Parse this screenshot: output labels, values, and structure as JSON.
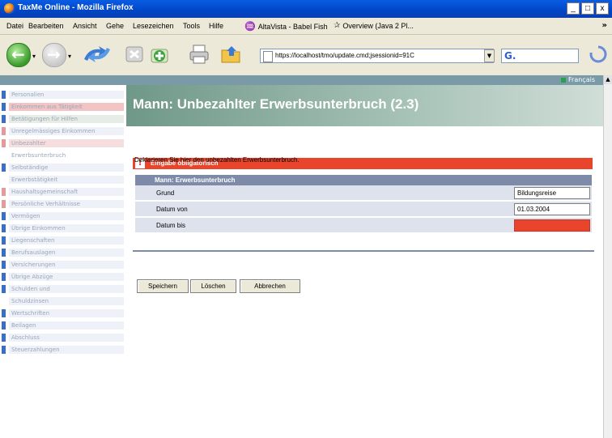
{
  "window": {
    "title": "TaxMe Online - Mozilla Firefox",
    "buttons": [
      "_",
      "□",
      "x"
    ]
  },
  "menu": {
    "items": [
      "Datei",
      "Bearbeiten",
      "Ansicht",
      "Gehe",
      "Lesezeichen",
      "Tools",
      "Hilfe"
    ],
    "bookmarks": [
      "AltaVista - Babel Fish",
      "Overview (Java 2 Pl..."
    ],
    "overflow": "»"
  },
  "toolbar": {
    "url": "https://localhost/tmo/update.cmd;jsessionid=91C",
    "search_value": "G."
  },
  "page": {
    "language": "Français",
    "title": "Mann: Unbezahlter Erwerbsunterbruch (2.3)",
    "error_label": "Eingabe obligatorisch",
    "error_mark": "!",
    "intro": "Deklarieren Sie hier den unbezahlten Erwerbsunterbruch.",
    "section_title": "Mann: Erwerbsunterbruch",
    "fields": [
      {
        "label": "Grund",
        "value": "Bildungsreise",
        "error": false
      },
      {
        "label": "Datum von",
        "value": "01.03.2004",
        "error": false
      },
      {
        "label": "Datum bis",
        "value": "",
        "error": true
      }
    ],
    "buttons": [
      "Speichern",
      "Löschen",
      "Abbrechen"
    ]
  },
  "sidebar": {
    "items": [
      {
        "label": "Personalien",
        "marker": "#3a6fc8",
        "bg": "#eef2f8"
      },
      {
        "label": "Einkommen aus Tätigkeit",
        "marker": "#3a6fc8",
        "bg": "#f2c4c4"
      },
      {
        "label": "Betätigungen für Hilfen",
        "marker": "#3a6fc8",
        "bg": "#e6ece6"
      },
      {
        "label": "Unregelmässiges Einkommen",
        "marker": "#e59a9a",
        "bg": "#eef2f8"
      },
      {
        "label": "Unbezahlter",
        "marker": "#e59a9a",
        "bg": "#f6dede"
      },
      {
        "label": "Erwerbsunterbruch",
        "marker": "#ffffff",
        "bg": "#ffffff"
      },
      {
        "label": "Selbständige",
        "marker": "#3a6fc8",
        "bg": "#eef2f8"
      },
      {
        "label": "Erwerbstätigkeit",
        "marker": "#ffffff",
        "bg": "#eef2f8"
      },
      {
        "label": "Haushaltsgemeinschaft",
        "marker": "#e59a9a",
        "bg": "#eef2f8"
      },
      {
        "label": "Persönliche Verhältnisse",
        "marker": "#e59a9a",
        "bg": "#eef2f8"
      },
      {
        "label": "Vermögen",
        "marker": "#3a6fc8",
        "bg": "#eef2f8"
      },
      {
        "label": "Übrige Einkommen",
        "marker": "#3a6fc8",
        "bg": "#eef2f8"
      },
      {
        "label": "Liegenschaften",
        "marker": "#3a6fc8",
        "bg": "#eef2f8"
      },
      {
        "label": "Berufsauslagen",
        "marker": "#3a6fc8",
        "bg": "#eef2f8"
      },
      {
        "label": "Versicherungen",
        "marker": "#3a6fc8",
        "bg": "#eef2f8"
      },
      {
        "label": "Übrige Abzüge",
        "marker": "#3a6fc8",
        "bg": "#eef2f8"
      },
      {
        "label": "Schulden und",
        "marker": "#3a6fc8",
        "bg": "#eef2f8"
      },
      {
        "label": "Schuldzinsen",
        "marker": "#ffffff",
        "bg": "#eef2f8"
      },
      {
        "label": "Wertschriften",
        "marker": "#3a6fc8",
        "bg": "#eef2f8"
      },
      {
        "label": "Beilagen",
        "marker": "#3a6fc8",
        "bg": "#eef2f8"
      },
      {
        "label": "Abschluss",
        "marker": "#3a6fc8",
        "bg": "#eef2f8"
      },
      {
        "label": "Steuerzahlungen",
        "marker": "#3a6fc8",
        "bg": "#eef2f8"
      }
    ]
  },
  "colors": {
    "title_bar": "#0046c7",
    "header_green": "#6f9888",
    "error_red": "#e8452c",
    "form_header": "#7d8ba8",
    "form_row": "#dde2ec"
  }
}
